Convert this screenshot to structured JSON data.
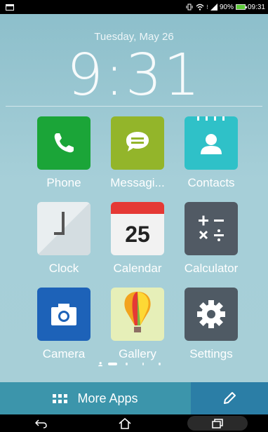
{
  "status_bar": {
    "battery_percent": "90%",
    "time": "09:31",
    "battery_color": "#5ecb3a"
  },
  "clock_widget": {
    "date": "Tuesday, May 26",
    "time": "9:31"
  },
  "apps": [
    {
      "label": "Phone",
      "icon": "phone-icon",
      "color": "#1ba538"
    },
    {
      "label": "Messagi...",
      "icon": "messaging-icon",
      "color": "#93b52a"
    },
    {
      "label": "Contacts",
      "icon": "contacts-icon",
      "color": "#2fc1c8"
    },
    {
      "label": "Clock",
      "icon": "clock-icon",
      "color": "#e9eef0"
    },
    {
      "label": "Calendar",
      "icon": "calendar-icon",
      "color": "#f2f2f2",
      "day": "25"
    },
    {
      "label": "Calculator",
      "icon": "calculator-icon",
      "color": "#515a64"
    },
    {
      "label": "Camera",
      "icon": "camera-icon",
      "color": "#1d62b8"
    },
    {
      "label": "Gallery",
      "icon": "gallery-icon",
      "color": "#e6efb8"
    },
    {
      "label": "Settings",
      "icon": "settings-icon",
      "color": "#4f5a64"
    }
  ],
  "page_indicator": {
    "pages": 4,
    "active": 1
  },
  "bottom_bar": {
    "more_apps_label": "More Apps",
    "accent": "#3c95ab"
  }
}
